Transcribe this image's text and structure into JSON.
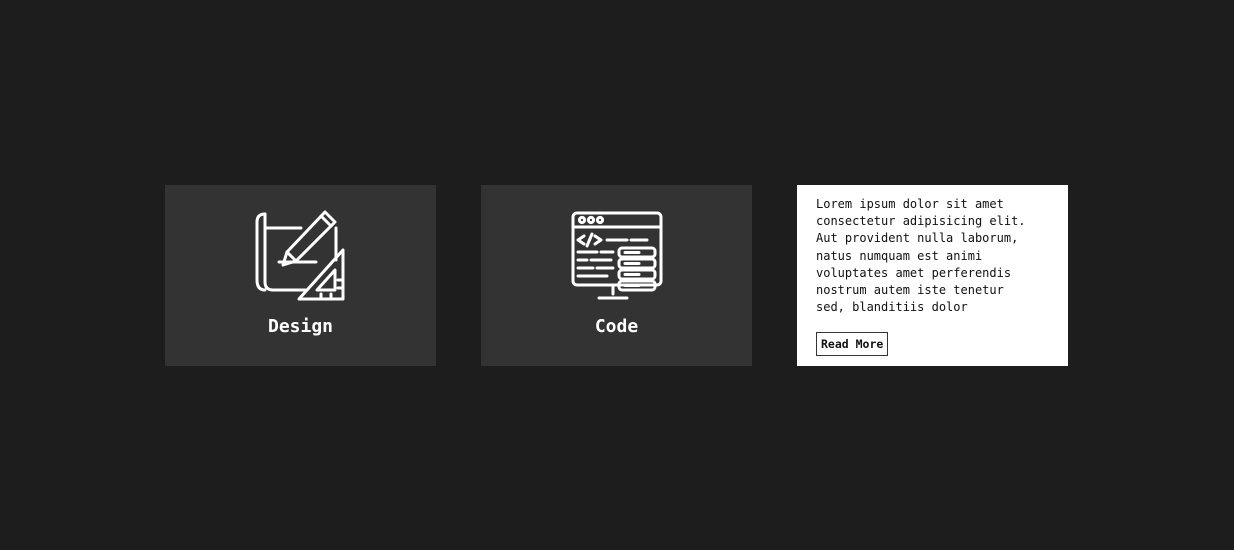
{
  "cards": [
    {
      "title": "Design",
      "icon": "blueprint-pencil-ruler-icon"
    },
    {
      "title": "Code",
      "icon": "monitor-code-database-icon"
    },
    {
      "text": "Lorem ipsum dolor sit amet\nconsectetur adipisicing elit.\nAut provident nulla laborum,\nnatus numquam est animi\nvoluptates amet perferendis\nnostrum autem iste tenetur\nsed, blanditiis dolor",
      "button_label": "Read More"
    }
  ],
  "colors": {
    "page_background": "#1d1d1d",
    "card_background": "#333333",
    "icon_and_title": "#ffffff",
    "text_card_background": "#ffffff",
    "text_color": "#111111"
  }
}
